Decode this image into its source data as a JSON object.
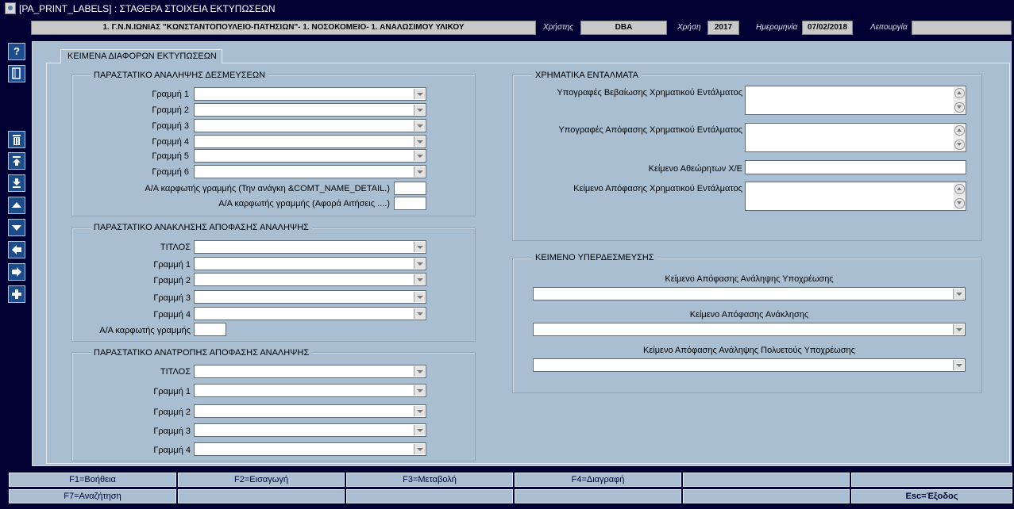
{
  "window": {
    "title": "[PA_PRINT_LABELS]  :  ΣΤΑΘΕΡΑ ΣΤΟΙΧΕΙΑ ΕΚΤΥΠΩΣΕΩΝ"
  },
  "context": {
    "organization": "1. Γ.Ν.Ν.ΙΩΝΙΑΣ \"ΚΩΝΣΤΑΝΤΟΠΟΥΛΕΙΟ-ΠΑΤΗΣΙΩΝ\"- 1. ΝΟΣΟΚΟΜΕΙΟ- 1. ΑΝΑΛΩΣΙΜΟΥ ΥΛΙΚΟΥ",
    "user_label": "Χρήστης",
    "user_value": "DBA",
    "year_label": "Χρήση",
    "year_value": "2017",
    "date_label": "Ημερομηνία",
    "date_value": "07/02/2018",
    "mode_label": "Λειτουργία",
    "mode_value": ""
  },
  "sidebar": {
    "icons": [
      "help-icon",
      "window-icon",
      "trash-icon",
      "first-record-icon",
      "last-record-icon",
      "previous-icon",
      "next-icon",
      "previous-block-icon",
      "next-block-icon",
      "add-icon"
    ]
  },
  "tab": {
    "label": "ΚΕΙΜΕΝΑ ΔΙΑΦΟΡΩΝ ΕΚΤΥΠΩΣΕΩΝ"
  },
  "group1": {
    "title": "ΠΑΡΑΣΤΑΤΙΚΟ ΑΝΑΛΗΨΗΣ ΔΕΣΜΕΥΣΕΩΝ",
    "lines": [
      "Γραμμή 1",
      "Γραμμή 2",
      "Γραμμή 3",
      "Γραμμή 4",
      "Γραμμή 5",
      "Γραμμή 6"
    ],
    "fixed1": "Α/Α καρφωτής γραμμής (Την ανάγκη &COMT_NAME_DETAIL.)",
    "fixed2": "Α/Α καρφωτής γραμμής (Αφορά Αιτήσεις ....)"
  },
  "group2": {
    "title": "ΠΑΡΑΣΤΑΤΙΚΟ ΑΝΑΚΛΗΣΗΣ ΑΠΟΦΑΣΗΣ ΑΝΑΛΗΨΗΣ",
    "lines": [
      "ΤΙΤΛΟΣ",
      "Γραμμή 1",
      "Γραμμή 2",
      "Γραμμή 3",
      "Γραμμή 4"
    ],
    "fixed": "Α/Α καρφωτής γραμμής"
  },
  "group3": {
    "title": "ΠΑΡΑΣΤΑΤΙΚΟ ΑΝΑΤΡΟΠΗΣ ΑΠΟΦΑΣΗΣ ΑΝΑΛΗΨΗΣ",
    "lines": [
      "ΤΙΤΛΟΣ",
      "Γραμμή 1",
      "Γραμμή 2",
      "Γραμμή 3",
      "Γραμμή 4"
    ]
  },
  "group4": {
    "title": "ΧΡΗΜΑΤΙΚΑ ΕΝΤΑΛΜΑΤΑ",
    "f1": "Υπογραφές Βεβαίωσης Χρηματικού Εντάλματος",
    "f2": "Υπογραφές Απόφασης Χρηματικού Εντάλματος",
    "f3": "Κείμενο Αθεώρητων Χ/Ε",
    "f4": "Κείμενο Απόφασης Χρηματικού Εντάλματος"
  },
  "group5": {
    "title": "ΚΕΙΜΕΝΟ ΥΠΕΡΔΕΣΜΕΥΣΗΣ",
    "f1": "Κείμενο Απόφασης Ανάληψης Υποχρέωσης",
    "f2": "Κείμενο Απόφασης Ανάκλησης",
    "f3": "Κείμενο Απόφασης Ανάληψης Πολυετούς Υποχρέωσης"
  },
  "fkeys": {
    "row1": [
      "F1=Βοήθεια",
      "F2=Εισαγωγή",
      "F3=Μεταβολή",
      "F4=Διαγραφή",
      "",
      ""
    ],
    "row2": [
      "F7=Αναζήτηση",
      "",
      "",
      "",
      "",
      "Esc=Έξοδος"
    ]
  }
}
